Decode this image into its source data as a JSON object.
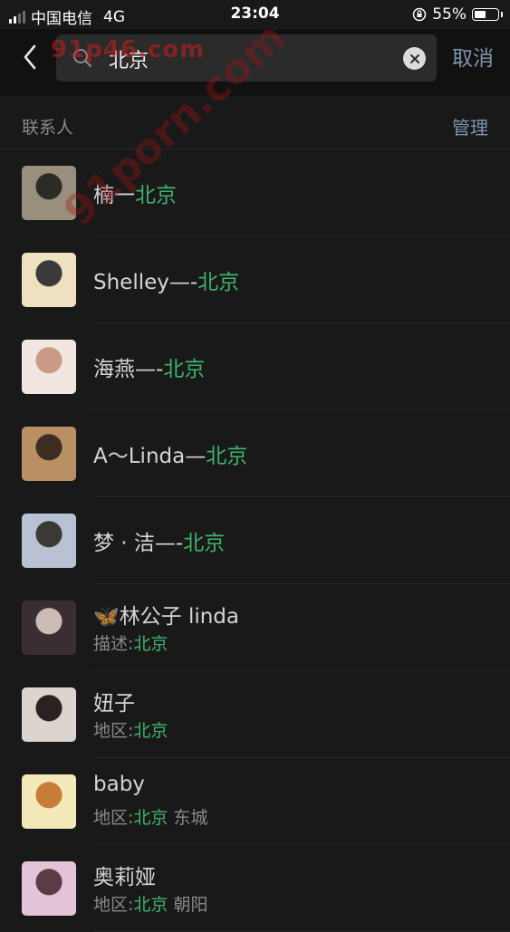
{
  "status_bar": {
    "carrier": "中国电信",
    "network": "4G",
    "time": "23:04",
    "battery_percent": "55%",
    "battery_level": 0.55
  },
  "search": {
    "back_icon": "chevron-left-icon",
    "search_icon": "magnifier-icon",
    "query": "北京",
    "clear_icon": "clear-circle-icon",
    "cancel_label": "取消"
  },
  "section": {
    "title": "联系人",
    "manage_label": "管理"
  },
  "watermarks": {
    "top": "91p46.com",
    "diagonal": "91porn.com"
  },
  "colors": {
    "background": "#191919",
    "highlight_green": "#3fb26a",
    "link_blue": "#7e93ad"
  },
  "contacts": [
    {
      "name_prefix": "楠一",
      "name_match": "北京",
      "name_suffix": "",
      "sub_label": "",
      "sub_match": "",
      "sub_suffix": ""
    },
    {
      "name_prefix": "Shelley—-",
      "name_match": "北京",
      "name_suffix": "",
      "sub_label": "",
      "sub_match": "",
      "sub_suffix": ""
    },
    {
      "name_prefix": "海燕—-",
      "name_match": "北京",
      "name_suffix": "",
      "sub_label": "",
      "sub_match": "",
      "sub_suffix": ""
    },
    {
      "name_prefix": "A～Linda—",
      "name_match": "北京",
      "name_suffix": "",
      "sub_label": "",
      "sub_match": "",
      "sub_suffix": ""
    },
    {
      "name_prefix": "梦 · 洁—-",
      "name_match": "北京",
      "name_suffix": "",
      "sub_label": "",
      "sub_match": "",
      "sub_suffix": ""
    },
    {
      "name_prefix": "🦋林公子 linda",
      "name_match": "",
      "name_suffix": "",
      "sub_label": "描述:",
      "sub_match": "北京",
      "sub_suffix": ""
    },
    {
      "name_prefix": "妞子",
      "name_match": "",
      "name_suffix": "",
      "sub_label": "地区:",
      "sub_match": "北京",
      "sub_suffix": ""
    },
    {
      "name_prefix": "baby",
      "name_match": "",
      "name_suffix": "",
      "sub_label": "地区:",
      "sub_match": "北京",
      "sub_suffix": " 东城"
    },
    {
      "name_prefix": "奥莉娅",
      "name_match": "",
      "name_suffix": "",
      "sub_label": "地区:",
      "sub_match": "北京",
      "sub_suffix": " 朝阳"
    }
  ]
}
